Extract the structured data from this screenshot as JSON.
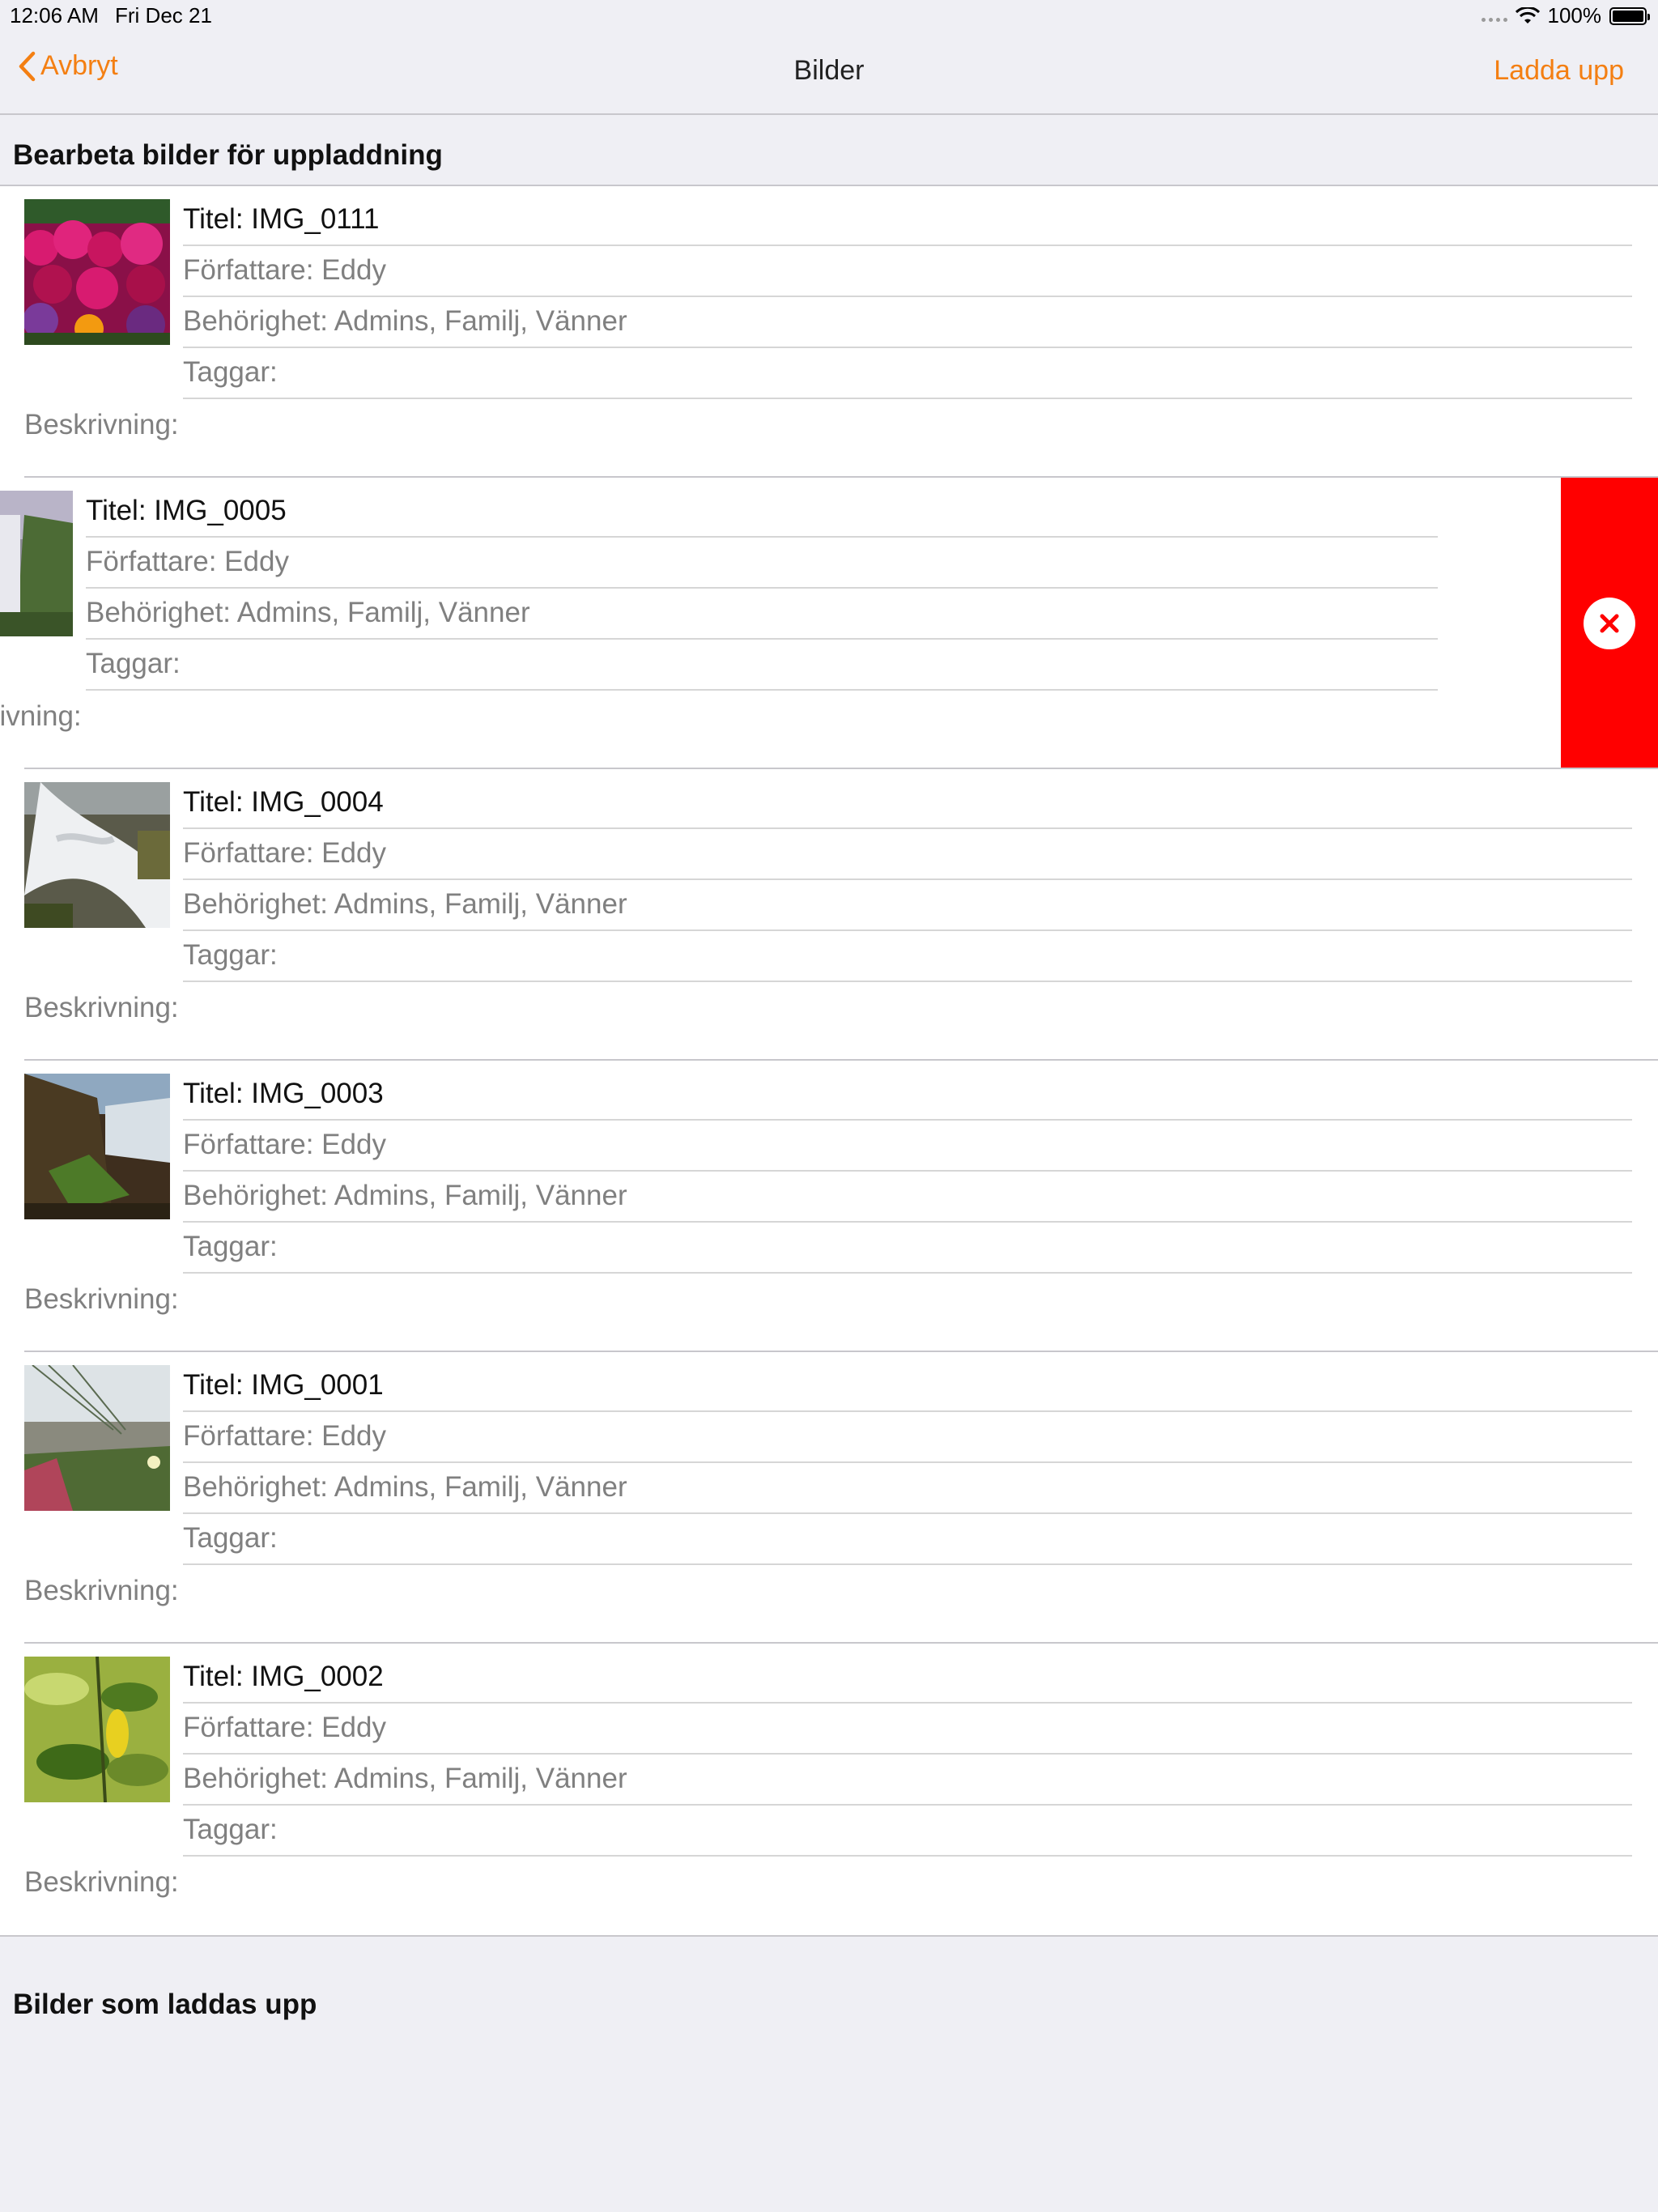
{
  "status_bar": {
    "time": "12:06 AM",
    "date": "Fri Dec 21",
    "battery": "100%"
  },
  "nav": {
    "back_label": "Avbryt",
    "title": "Bilder",
    "upload_label": "Ladda upp"
  },
  "section_edit": "Bearbeta bilder för uppladdning",
  "section_uploading": "Bilder som laddas upp",
  "items": [
    {
      "title": "Titel: IMG_0111",
      "author": "Författare: Eddy",
      "permission": "Behörighet: Admins, Familj, Vänner",
      "tags": "Taggar:",
      "description": "Beskrivning:"
    },
    {
      "title": "Titel: IMG_0005",
      "author": "Författare: Eddy",
      "permission": "Behörighet: Admins, Familj, Vänner",
      "tags": "Taggar:",
      "description": "Beskrivning:"
    },
    {
      "title": "Titel: IMG_0004",
      "author": "Författare: Eddy",
      "permission": "Behörighet: Admins, Familj, Vänner",
      "tags": "Taggar:",
      "description": "Beskrivning:"
    },
    {
      "title": "Titel: IMG_0003",
      "author": "Författare: Eddy",
      "permission": "Behörighet: Admins, Familj, Vänner",
      "tags": "Taggar:",
      "description": "Beskrivning:"
    },
    {
      "title": "Titel: IMG_0001",
      "author": "Författare: Eddy",
      "permission": "Behörighet: Admins, Familj, Vänner",
      "tags": "Taggar:",
      "description": "Beskrivning:"
    },
    {
      "title": "Titel: IMG_0002",
      "author": "Författare: Eddy",
      "permission": "Behörighet: Admins, Familj, Vänner",
      "tags": "Taggar:",
      "description": "Beskrivning:"
    }
  ],
  "colors": {
    "accent": "#f47f12",
    "delete": "#ff0000",
    "background": "#efeff4"
  }
}
